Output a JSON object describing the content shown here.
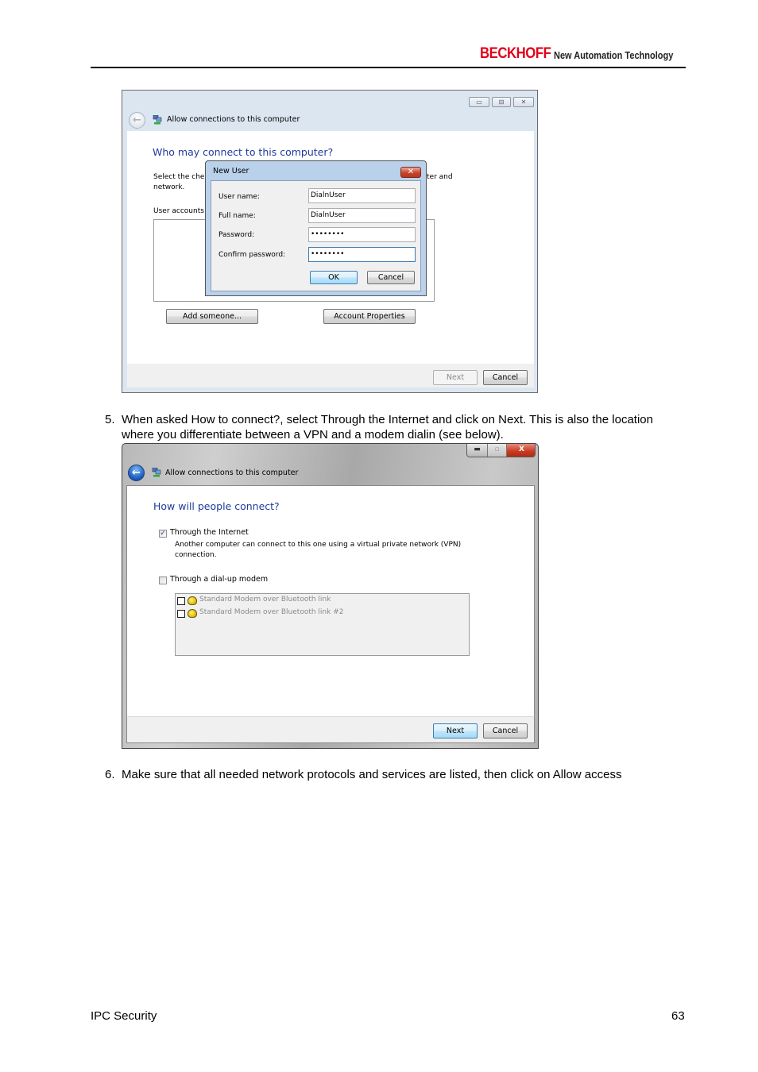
{
  "header": {
    "brand": "BECKHOFF",
    "tagline": "New Automation Technology",
    "brand_color": "#e2001a"
  },
  "screenshot1": {
    "window_title": "Allow connections to this computer",
    "caption_buttons": {
      "minimize": "▭",
      "maximize": "⊟",
      "close": "✕"
    },
    "heading": "Who may connect to this computer?",
    "instruction_left": "Select the che",
    "instruction_right": "ter and",
    "instruction_line2": "network.",
    "user_accounts_label": "User accounts",
    "add_someone_button": "Add someone...",
    "account_properties_button": "Account Properties",
    "next_button": "Next",
    "cancel_button": "Cancel",
    "new_user_dialog": {
      "title": "New User",
      "close_glyph": "✕",
      "fields": [
        {
          "label": "User name:",
          "value": "DialnUser"
        },
        {
          "label": "Full name:",
          "value": "DialnUser"
        },
        {
          "label": "Password:",
          "value": "••••••••"
        },
        {
          "label": "Confirm password:",
          "value": "••••••••"
        }
      ],
      "ok_button": "OK",
      "cancel_button": "Cancel"
    }
  },
  "step5": {
    "number": "5.",
    "line1": "When asked How to connect?, select Through the Internet and click on Next. This is also the location",
    "line2": "where you differentiate between a VPN and a modem dialin (see below)."
  },
  "screenshot2": {
    "window_title": "Allow connections to this computer",
    "caption_buttons": {
      "minimize": "▬",
      "maximize": "▫",
      "close": "X"
    },
    "heading": "How will people connect?",
    "option_internet": {
      "label": "Through the Internet",
      "checked": true,
      "check_glyph": "✓"
    },
    "internet_description_line1": "Another computer can connect to this one using a virtual private network (VPN)",
    "internet_description_line2": "connection.",
    "option_modem": {
      "label": "Through a dial-up modem",
      "checked": false
    },
    "modems": [
      {
        "label": "Standard Modem over Bluetooth link",
        "checked": false
      },
      {
        "label": "Standard Modem over Bluetooth link #2",
        "checked": false
      }
    ],
    "next_button": "Next",
    "cancel_button": "Cancel"
  },
  "step6": {
    "number": "6.",
    "text": "Make sure that all needed network protocols and services are listed, then click on Allow access"
  },
  "footer": {
    "section": "IPC Security",
    "page_number": "63"
  }
}
